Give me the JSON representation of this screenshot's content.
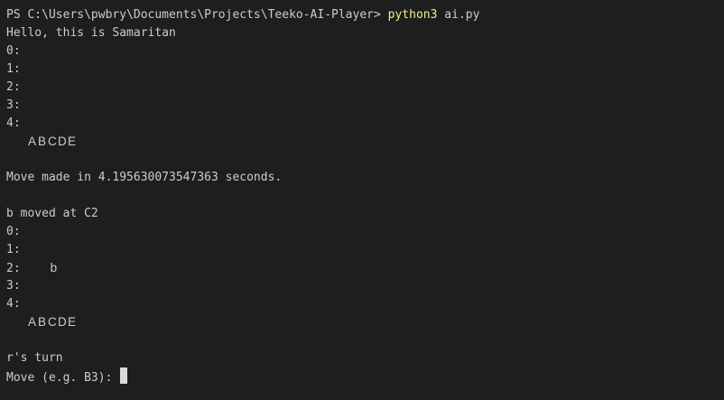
{
  "prompt": {
    "prefix": "PS C:\\Users\\pwbry\\Documents\\Projects\\Teeko-AI-Player> ",
    "command": "python3",
    "argument": " ai.py"
  },
  "greeting": "Hello, this is Samaritan",
  "board1": {
    "rows": [
      "0:",
      "1:",
      "2:",
      "3:",
      "4:"
    ],
    "columns": [
      "A",
      "B",
      "C",
      "D",
      "E"
    ]
  },
  "move_time": "Move made in 4.195630073547363 seconds.",
  "moved_line": "b moved at C2",
  "board2": {
    "rows": [
      "0:",
      "1:",
      "2:",
      "3:",
      "4:"
    ],
    "row2_piece": "b",
    "columns": [
      "A",
      "B",
      "C",
      "D",
      "E"
    ]
  },
  "turn": "r's turn",
  "input_prompt": "Move (e.g. B3): "
}
